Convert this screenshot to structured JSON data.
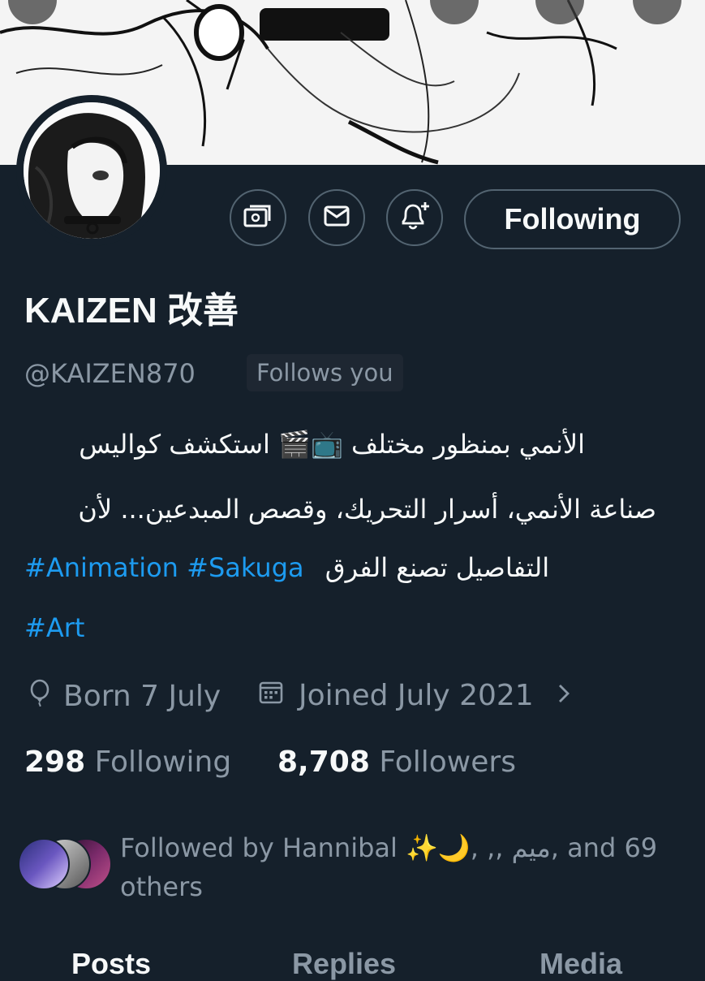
{
  "profile": {
    "display_name": "KAIZEN 改善",
    "handle": "@KAIZEN870",
    "follows_you": "Follows you"
  },
  "actions": {
    "follow_label": "Following",
    "subscribe_icon": "money-icon",
    "message_icon": "envelope-icon",
    "notify_icon": "bell-plus-icon"
  },
  "bio": {
    "line1": "الأنمي بمنظور مختلف 📺🎬 استكشف كواليس",
    "line2": "صناعة الأنمي، أسرار التحريك، وقصص المبدعين... لأن",
    "line3_text": "التفاصيل تصنع الفرق",
    "hashtags_line3": [
      "#Animation",
      "#Sakuga"
    ],
    "hashtag_line4": "#Art"
  },
  "meta": {
    "birthday": "Born 7 July",
    "joined": "Joined July 2021"
  },
  "stats": {
    "following_count": "298",
    "following_label": "Following",
    "followers_count": "8,708",
    "followers_label": "Followers"
  },
  "followed_by": {
    "text": "Followed by Hannibal ✨🌙, ,, ميم, and 69 others"
  },
  "tabs": [
    "Posts",
    "Replies",
    "Media"
  ],
  "colors": {
    "background": "#15202b",
    "text": "#f7f9f9",
    "muted": "#8b98a5",
    "link": "#1d9bf0",
    "border": "#536471"
  }
}
